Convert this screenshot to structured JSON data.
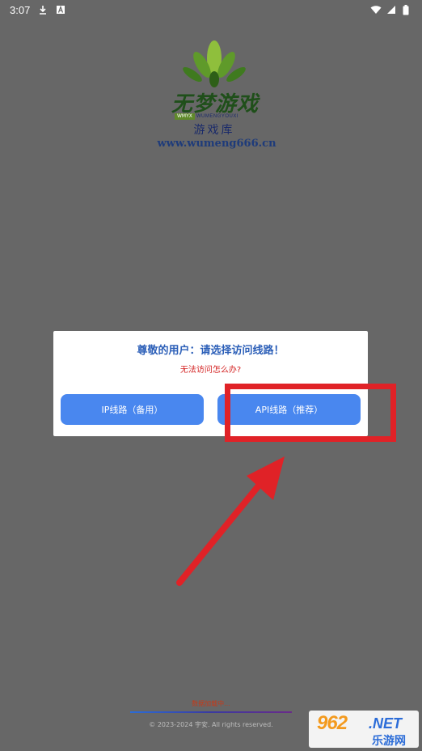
{
  "status_bar": {
    "time": "3:07"
  },
  "logo": {
    "name_cn": "无梦游戏",
    "strip_green": "WMYX",
    "strip_text": "WUMENGYOUXI",
    "subtitle": "游戏库",
    "url": "www.wumeng666.cn"
  },
  "dialog": {
    "title": "尊敬的用户：请选择访问线路！",
    "help_link": "无法访问怎么办?",
    "button_ip": "IP线路（备用）",
    "button_api": "API线路（推荐）"
  },
  "footer": {
    "loading_text": "数据加载中...",
    "copyright": "© 2023-2024 宇安. All rights reserved."
  },
  "watermark": {
    "number": "962",
    "suffix": ".NET",
    "text_cn": "乐游网"
  },
  "colors": {
    "background": "#676767",
    "button": "#4987ef",
    "title": "#2c5fb8",
    "help": "#d32020",
    "highlight": "#e02227"
  }
}
